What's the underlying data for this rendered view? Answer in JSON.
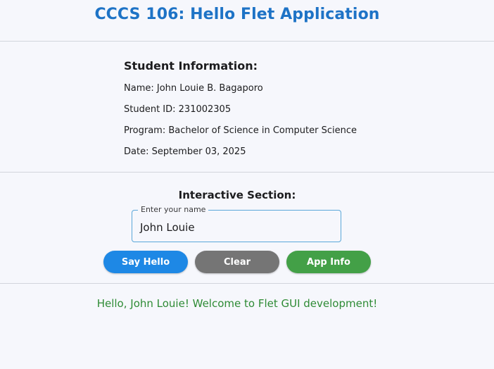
{
  "header": {
    "title": "CCCS 106: Hello Flet Application"
  },
  "student_info": {
    "heading": "Student Information:",
    "name": "Name: John Louie B. Bagaporo",
    "student_id": "Student ID: 231002305",
    "program": "Program: Bachelor of Science in Computer Science",
    "date": "Date: September 03, 2025"
  },
  "interactive": {
    "heading": "Interactive Section:",
    "name_field": {
      "label": "Enter your name",
      "value": "John Louie"
    },
    "buttons": {
      "say_hello": "Say Hello",
      "clear": "Clear",
      "app_info": "App Info"
    }
  },
  "output": {
    "message": "Hello, John Louie! Welcome to Flet GUI development!"
  },
  "colors": {
    "title": "#1e73c6",
    "say_hello": "#1e88e5",
    "clear": "#757575",
    "app_info": "#43a047",
    "message": "#2e8b35",
    "field_border": "#5aa7d9"
  }
}
